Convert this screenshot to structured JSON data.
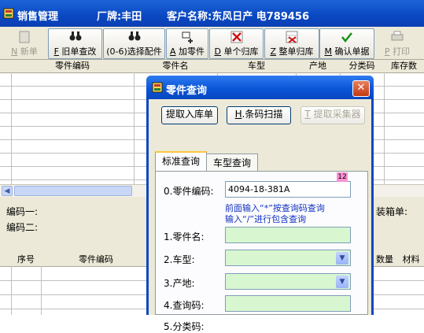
{
  "window": {
    "title": "销售管理",
    "factory": "厂牌:丰田",
    "customer": "客户名称:东风日产 电789456",
    "colors": {
      "titlebar": "#0a48c2",
      "accent": "#1030c0"
    }
  },
  "toolbar": {
    "buttons": [
      {
        "key": "N",
        "label": "新单",
        "icon": "new-doc-icon",
        "enabled": false
      },
      {
        "key": "F",
        "label": "旧单查改",
        "icon": "binoculars-icon",
        "enabled": true
      },
      {
        "key": "(0-6)",
        "label": "选择配件",
        "icon": "binoculars-icon",
        "enabled": true
      },
      {
        "key": "A",
        "label": "加零件",
        "icon": "add-item-icon",
        "enabled": true
      },
      {
        "key": "D",
        "label": "单个归库",
        "icon": "red-x-icon",
        "enabled": true
      },
      {
        "key": "Z",
        "label": "整单归库",
        "icon": "grid-x-icon",
        "enabled": true
      },
      {
        "key": "M",
        "label": "确认单据",
        "icon": "checkmark-icon",
        "enabled": true
      },
      {
        "key": "P",
        "label": "打印",
        "icon": "printer-icon",
        "enabled": false
      }
    ]
  },
  "grid": {
    "columns": [
      "零件编码",
      "零件名",
      "车型",
      "产地",
      "分类码",
      "库存数"
    ]
  },
  "info": {
    "code1": "编码一:",
    "code2": "编码二:",
    "box": "装箱单:"
  },
  "grid2": {
    "columns": [
      "序号",
      "零件编码",
      "数量",
      "材料"
    ]
  },
  "dialog": {
    "title": "零件查询",
    "buttons": {
      "fetch": "提取入库单",
      "scan_key": "H",
      "scan": "条码扫描",
      "collect_key": "T",
      "collect": "提取采集器"
    },
    "tabs": [
      "标准查询",
      "车型查询"
    ],
    "fields": {
      "code_label": "0.零件编码:",
      "code_value": "4094-18-381A",
      "code_badge": "12",
      "hint1": "前面输入“*”按查询码查询",
      "hint2": "输入“/”进行包含查询",
      "name_label": "1.零件名:",
      "model_label": "2.车型:",
      "origin_label": "3.产地:",
      "query_label": "4.查询码:",
      "category_label": "5.分类码:"
    }
  }
}
